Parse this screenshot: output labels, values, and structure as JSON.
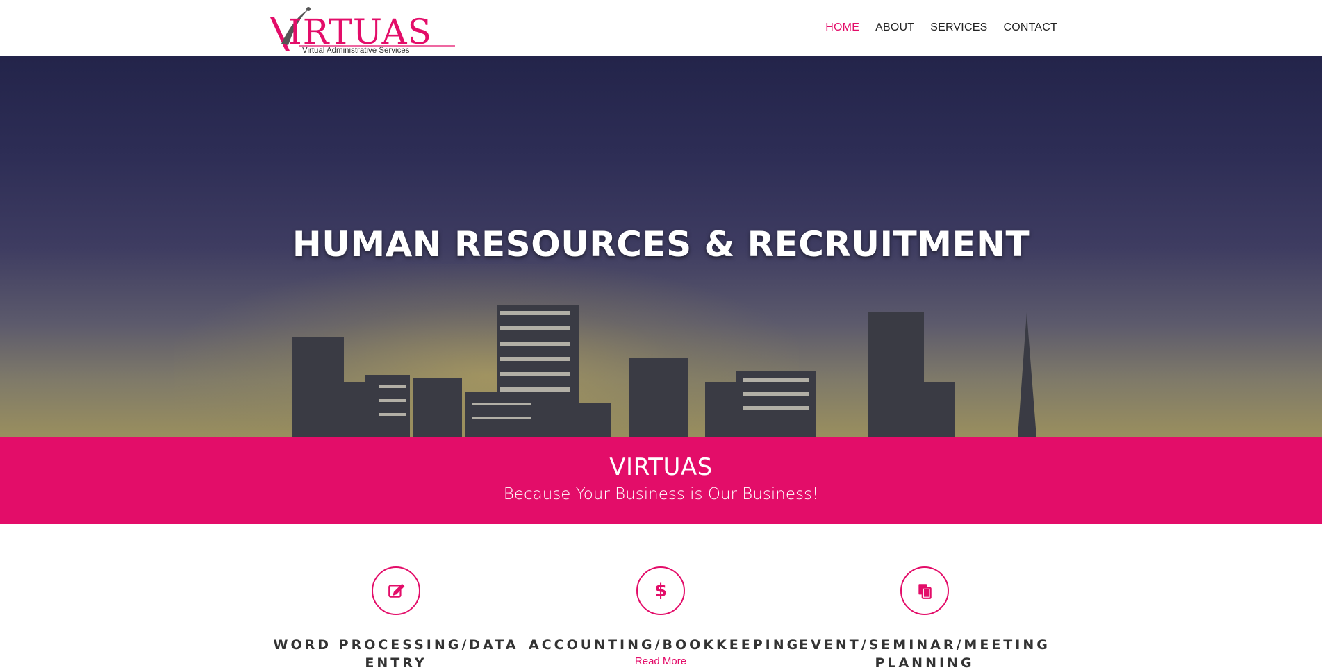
{
  "brand": {
    "logo_text": "VIRTUAS",
    "logo_tagline": "Virtual Administrative Services",
    "accent_color": "#e30d69"
  },
  "nav": {
    "items": [
      {
        "label": "HOME",
        "active": true
      },
      {
        "label": "ABOUT",
        "active": false
      },
      {
        "label": "SERVICES",
        "active": false
      },
      {
        "label": "CONTACT",
        "active": false
      }
    ]
  },
  "hero": {
    "title": "HUMAN RESOURCES & RECRUITMENT"
  },
  "band": {
    "title": "VIRTUAS",
    "subtitle": "Because Your Business is Our Business!"
  },
  "services": [
    {
      "title_line1": "WORD PROCESSING/DATA",
      "title_line2": "ENTRY",
      "icon": "edit-icon"
    },
    {
      "title_line1": "ACCOUNTING/BOOKKEEPING",
      "title_line2": "",
      "icon": "dollar-icon",
      "link": "Read More"
    },
    {
      "title_line1": "EVENT/SEMINAR/MEETING",
      "title_line2": "PLANNING",
      "icon": "copy-icon"
    }
  ]
}
